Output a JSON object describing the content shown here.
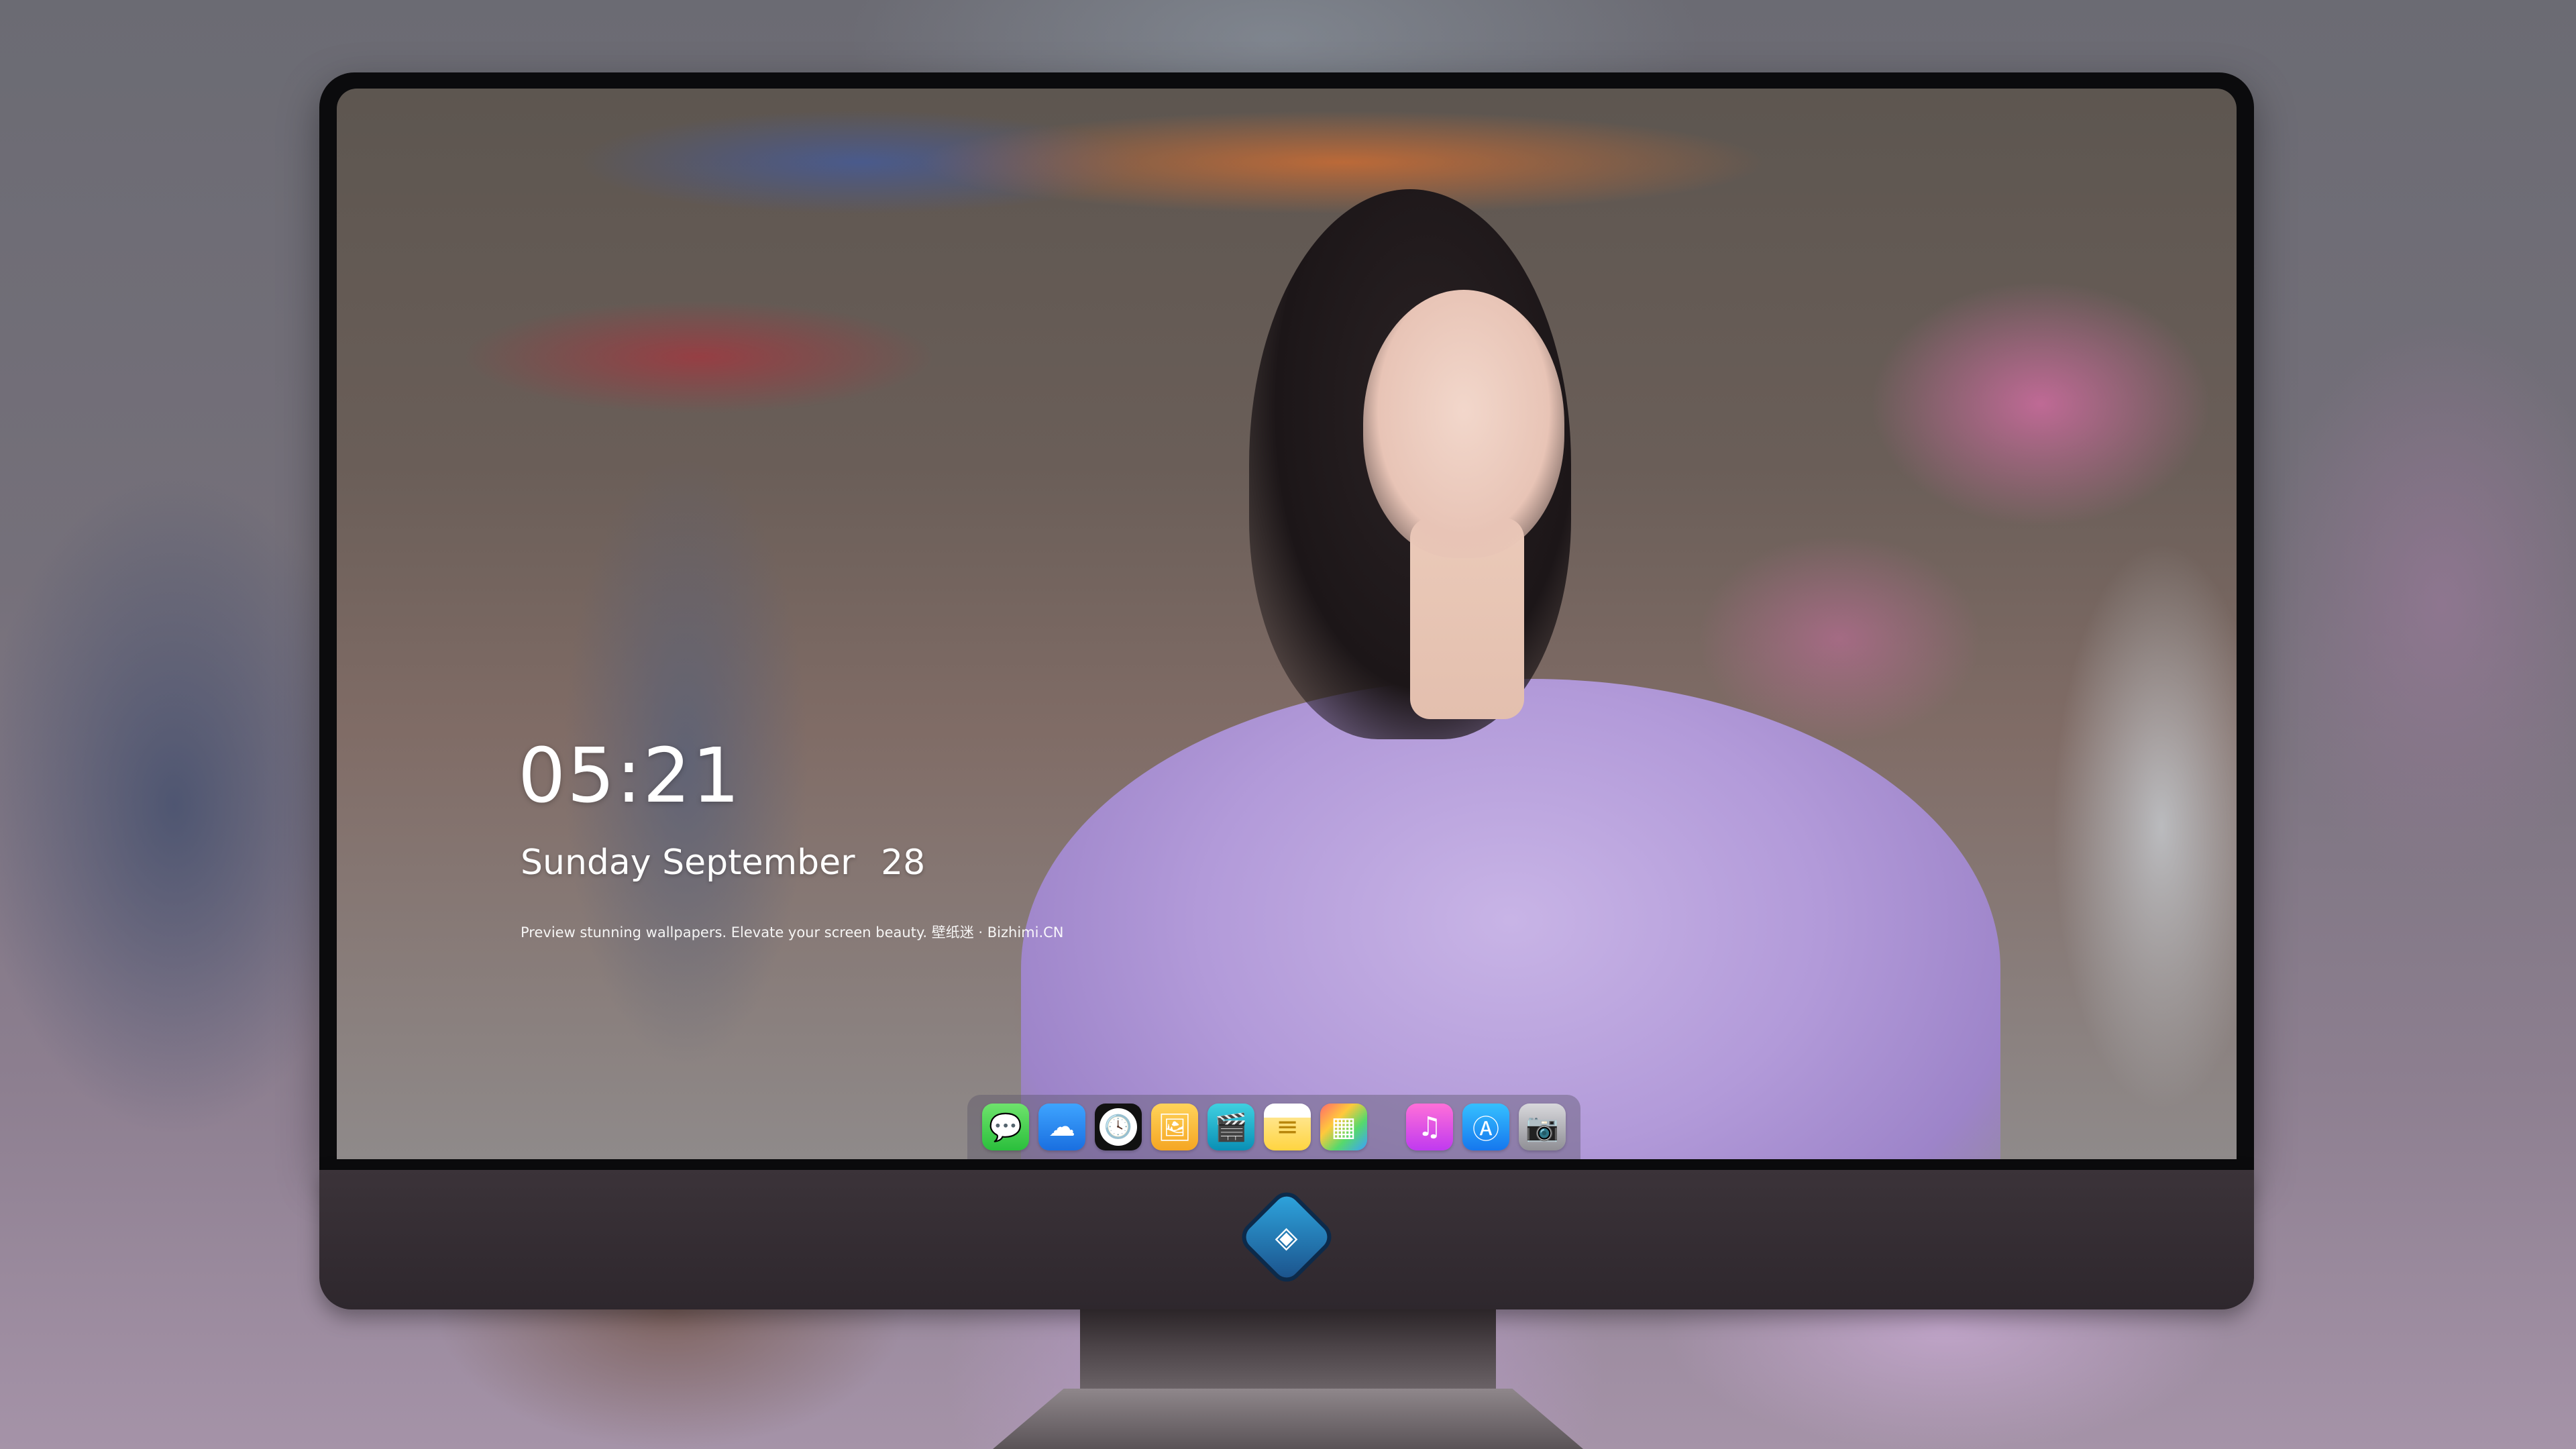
{
  "lock_screen": {
    "time": "05:21",
    "weekday": "Sunday",
    "month": "September",
    "day": "28",
    "tagline": "Preview stunning wallpapers. Elevate your screen beauty. 壁纸迷 · Bizhimi.CN"
  },
  "dock": {
    "apps": [
      {
        "name": "Messages",
        "icon": "message-bubble-icon",
        "glyph": "💬"
      },
      {
        "name": "Weather",
        "icon": "weather-cloud-icon",
        "glyph": "☁"
      },
      {
        "name": "Clock",
        "icon": "clock-icon",
        "glyph": "🕓"
      },
      {
        "name": "Preview",
        "icon": "preview-icon",
        "glyph": "🖼"
      },
      {
        "name": "Clips",
        "icon": "clapperboard-icon",
        "glyph": "🎬"
      },
      {
        "name": "Notes",
        "icon": "notes-icon",
        "glyph": "≡"
      },
      {
        "name": "Photos",
        "icon": "photos-icon",
        "glyph": "▦"
      },
      {
        "name": "Music",
        "icon": "music-note-icon",
        "glyph": "♫"
      },
      {
        "name": "App Store",
        "icon": "app-store-icon",
        "glyph": "Ⓐ"
      },
      {
        "name": "Camera",
        "icon": "camera-icon",
        "glyph": "📷"
      }
    ]
  },
  "monitor": {
    "chin_logo_icon": "dragon-mascot-icon"
  },
  "colors": {
    "robe_lavender": "#b29ad9",
    "chin": "#2e272d",
    "bezel": "#0b0b0d"
  }
}
